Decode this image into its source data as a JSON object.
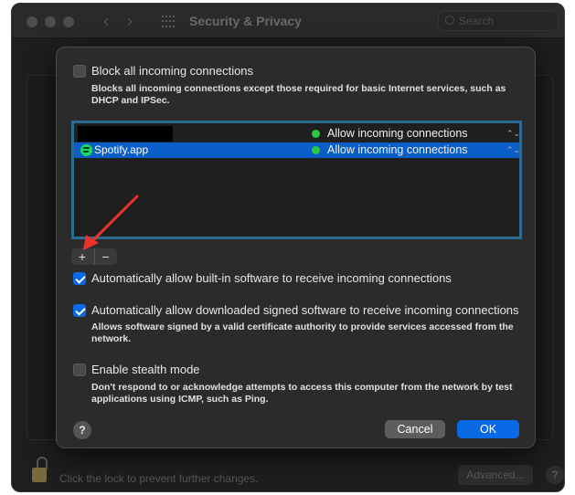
{
  "window": {
    "title": "Security & Privacy",
    "search_placeholder": "Search",
    "nav_back": "‹",
    "nav_forward": "›"
  },
  "background": {
    "lock_text": "Click the lock to prevent further changes.",
    "advanced_label": "Advanced...",
    "help_label": "?"
  },
  "sheet": {
    "block_all": {
      "label": "Block all incoming connections",
      "checked": false,
      "description": "Blocks all incoming connections except those required for basic Internet services, such as DHCP and IPSec."
    },
    "apps": [
      {
        "name": "",
        "redacted": true,
        "status": "Allow incoming connections",
        "status_color": "#28c840",
        "selected": false
      },
      {
        "name": "Spotify.app",
        "icon": "spotify-icon",
        "status": "Allow incoming connections",
        "status_color": "#28c840",
        "selected": true
      }
    ],
    "add_label": "+",
    "remove_label": "−",
    "builtin": {
      "label": "Automatically allow built-in software to receive incoming connections",
      "checked": true
    },
    "signed": {
      "label": "Automatically allow downloaded signed software to receive incoming connections",
      "checked": true,
      "description": "Allows software signed by a valid certificate authority to provide services accessed from the network."
    },
    "stealth": {
      "label": "Enable stealth mode",
      "checked": false,
      "description": "Don't respond to or acknowledge attempts to access this computer from the network by test applications using ICMP, such as Ping."
    },
    "help_label": "?",
    "cancel_label": "Cancel",
    "ok_label": "OK"
  },
  "colors": {
    "accent": "#0a6ae6",
    "selection": "#0a5ec7",
    "list_border": "#2c6b93",
    "annotation_arrow": "#e8322a"
  }
}
